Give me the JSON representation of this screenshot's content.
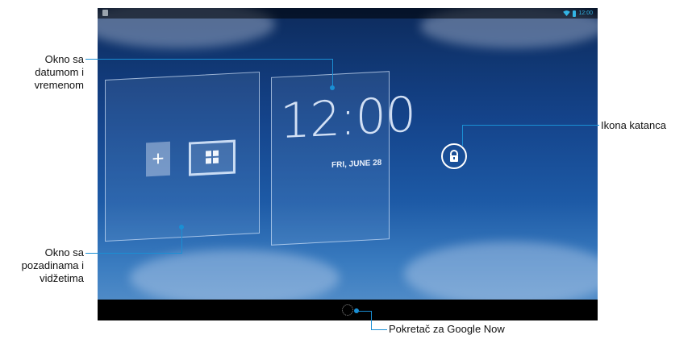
{
  "statusbar": {
    "time": "12:00"
  },
  "lockscreen": {
    "clock": "12:00",
    "date": "FRI, JUNE 28",
    "add_symbol": "+"
  },
  "callouts": {
    "datetime": [
      "Okno sa",
      "datumom i",
      "vremenom"
    ],
    "wallpaper": [
      "Okno sa",
      "pozadinama i",
      "vidžetima"
    ],
    "lock": "Ikona katanca",
    "google_now": "Pokretač za Google Now"
  },
  "icons": {
    "lock": "lock-icon",
    "widgets": "widgets-icon",
    "add": "add-icon",
    "google_now": "google-now-icon",
    "wifi": "wifi-icon",
    "battery": "battery-icon"
  },
  "colors": {
    "callout_line": "#1a8fd4",
    "status_accent": "#33b5e5"
  }
}
